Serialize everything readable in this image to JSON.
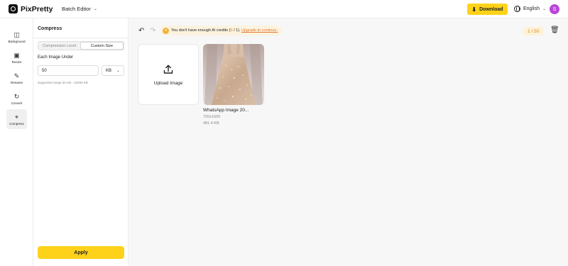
{
  "header": {
    "brand": "PixPretty",
    "menu_label": "Batch Editor",
    "download_label": "Download",
    "language": "English",
    "avatar_initial": "S"
  },
  "rail": {
    "items": [
      {
        "label": "Background",
        "icon": "background-icon"
      },
      {
        "label": "Resize",
        "icon": "resize-icon"
      },
      {
        "label": "Rename",
        "icon": "rename-icon"
      },
      {
        "label": "Convert",
        "icon": "convert-icon"
      },
      {
        "label": "Compress",
        "icon": "compress-icon",
        "active": true
      }
    ]
  },
  "panel": {
    "title": "Compress",
    "tabs": [
      "Compression Level",
      "Custom Size"
    ],
    "selected_tab": "Custom Size",
    "field_label": "Each Image Under",
    "size_value": "50",
    "unit": "KB",
    "hint": "Supported range:20 KB - 10260 KB",
    "apply_label": "Apply"
  },
  "workspace": {
    "credits_prefix": "You don't have enough AI credits (",
    "credits_value": "0",
    "credits_mid": " / 1). ",
    "credits_link": "Upgrade to continue.",
    "counter": "1 / 50",
    "upload_label": "Upload Image",
    "images": [
      {
        "name": "WhatsApp Image 20...",
        "dims": "720x1600",
        "size": "481.4 KB"
      }
    ]
  },
  "colors": {
    "accent": "#ffd21a",
    "avatar": "#b847d8",
    "credit_text": "#d98c1a"
  }
}
